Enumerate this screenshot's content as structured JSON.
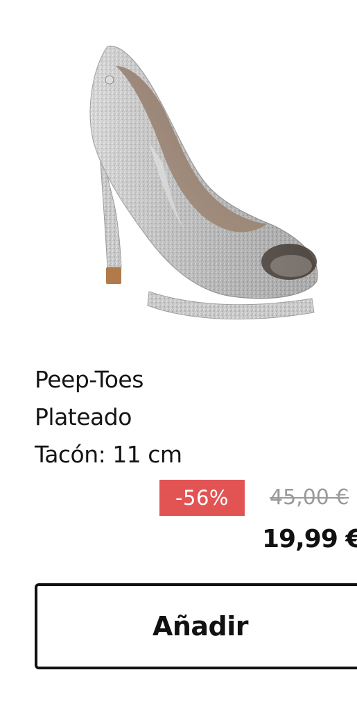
{
  "product": {
    "image_icon": "silver-glitter-peep-toe-shoe",
    "title_line_1": "Peep-Toes",
    "title_line_2": "Plateado",
    "title_line_3": "Tacón: 11 cm"
  },
  "pricing": {
    "discount_label": "-56%",
    "old_price": "45,00 €",
    "new_price": "19,99 €",
    "discount_color": "#e25454"
  },
  "actions": {
    "add_label": "Añadir"
  }
}
